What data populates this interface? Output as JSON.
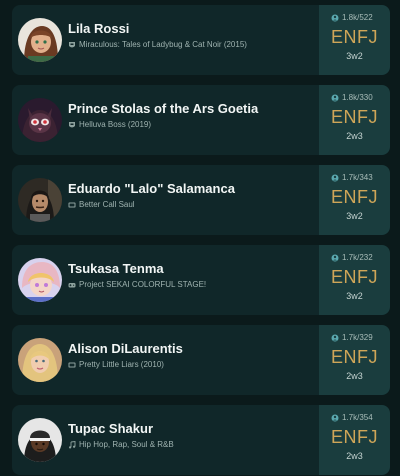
{
  "colors": {
    "background": "#0b1a1b",
    "card": "#102729",
    "type_panel": "#1a3d3e",
    "mbti_gold": "#cfa658"
  },
  "profiles": [
    {
      "name": "Lila Rossi",
      "source": "Miraculous: Tales of Ladybug & Cat Noir (2015)",
      "source_icon": "tv-badge-icon",
      "stats": "1.8k/522",
      "type": "ENFJ",
      "wing": "3w2",
      "avatar": "lila-rossi-avatar"
    },
    {
      "name": "Prince Stolas of the Ars Goetia",
      "source": "Helluva Boss (2019)",
      "source_icon": "tv-badge-icon",
      "stats": "1.8k/330",
      "type": "ENFJ",
      "wing": "2w3",
      "avatar": "stolas-avatar"
    },
    {
      "name": "Eduardo \"Lalo\" Salamanca",
      "source": "Better Call Saul",
      "source_icon": "tv-icon",
      "stats": "1.7k/343",
      "type": "ENFJ",
      "wing": "3w2",
      "avatar": "lalo-avatar"
    },
    {
      "name": "Tsukasa Tenma",
      "source": "Project SEKAI COLORFUL STAGE!",
      "source_icon": "gamepad-icon",
      "stats": "1.7k/232",
      "type": "ENFJ",
      "wing": "3w2",
      "avatar": "tsukasa-avatar"
    },
    {
      "name": "Alison DiLaurentis",
      "source": "Pretty Little Liars (2010)",
      "source_icon": "tv-icon",
      "stats": "1.7k/329",
      "type": "ENFJ",
      "wing": "2w3",
      "avatar": "alison-avatar"
    },
    {
      "name": "Tupac Shakur",
      "source": "Hip Hop, Rap, Soul & R&B",
      "source_icon": "music-note-icon",
      "stats": "1.7k/354",
      "type": "ENFJ",
      "wing": "2w3",
      "avatar": "tupac-avatar"
    }
  ]
}
